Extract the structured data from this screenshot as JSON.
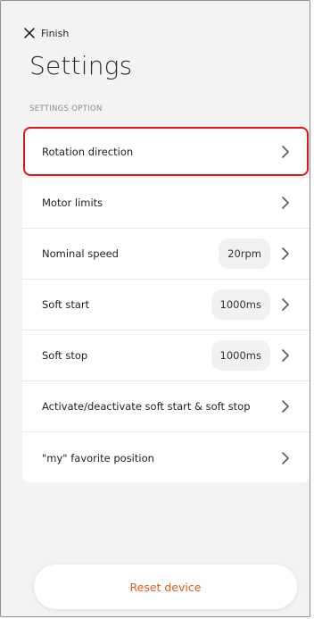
{
  "header": {
    "finish_label": "Finish",
    "close_icon": "close-icon",
    "title": "Settings"
  },
  "section": {
    "label": "SETTINGS OPTION"
  },
  "settings": {
    "items": [
      {
        "label": "Rotation direction",
        "value": "",
        "selected": true,
        "icon": "chevron-right-icon"
      },
      {
        "label": "Motor limits",
        "value": "",
        "icon": "chevron-right-icon"
      },
      {
        "label": "Nominal speed",
        "value": "20rpm",
        "icon": "chevron-right-icon"
      },
      {
        "label": "Soft start",
        "value": "1000ms",
        "icon": "chevron-right-icon"
      },
      {
        "label": "Soft stop",
        "value": "1000ms",
        "icon": "chevron-right-icon"
      },
      {
        "label": "Activate/deactivate soft start & soft stop",
        "value": "",
        "icon": "chevron-right-icon"
      },
      {
        "label": "\"my\" favorite position",
        "value": "",
        "icon": "chevron-right-icon"
      }
    ]
  },
  "footer": {
    "reset_label": "Reset device"
  },
  "colors": {
    "highlight": "#e0141e",
    "reset_text": "#e65a19",
    "background": "#f3f3f4"
  }
}
